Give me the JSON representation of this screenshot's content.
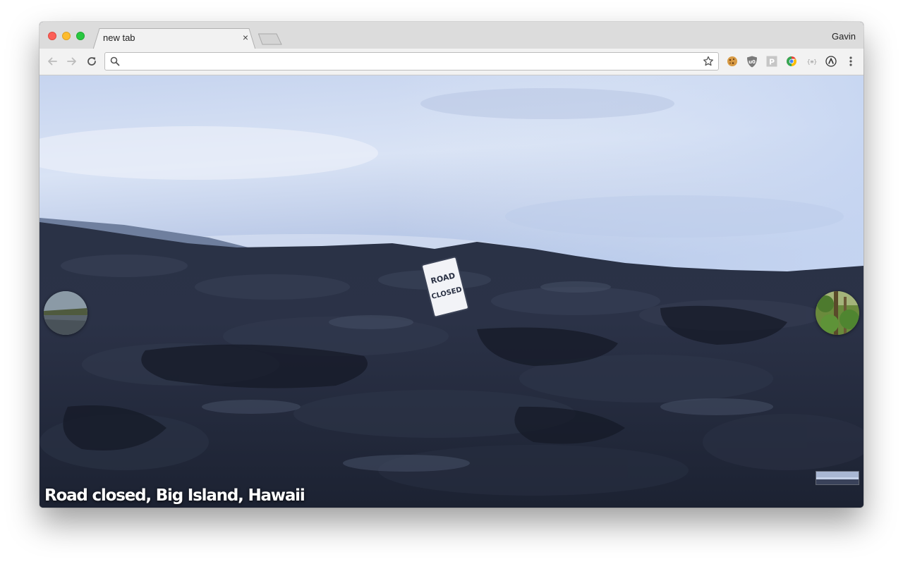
{
  "browser": {
    "tab": {
      "title": "new tab",
      "close_symbol": "×"
    },
    "profile_name": "Gavin",
    "omnibox": {
      "value": "",
      "placeholder": ""
    },
    "extensions": [
      "cookie-icon",
      "ublock-icon",
      "p-extension-icon",
      "chrome-color-icon",
      "json-viewer-icon",
      "arc-icon"
    ],
    "extension_labels": {
      "p_extension": "P",
      "json_viewer": "{≡}"
    }
  },
  "page": {
    "caption": "Road closed, Big Island, Hawaii",
    "sign_text": [
      "ROAD",
      "CLOSED"
    ]
  },
  "colors": {
    "sky": "#c9d6ee",
    "lava": "#2a3146",
    "accent_close": "#fc5f57",
    "accent_min": "#fdbc2e",
    "accent_max": "#28c840"
  }
}
